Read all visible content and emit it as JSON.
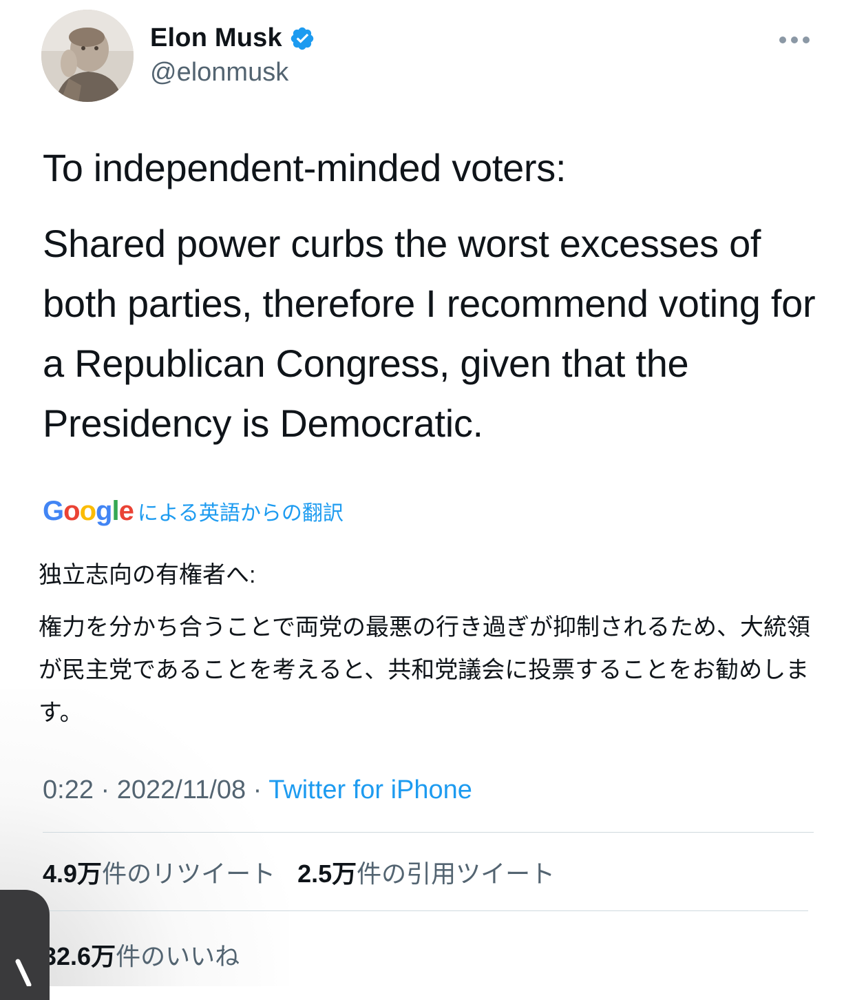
{
  "author": {
    "name": "Elon Musk",
    "handle": "@elonmusk",
    "verified_color": "#1d9bf0"
  },
  "tweet": {
    "line1": "To independent-minded voters:",
    "line2": "Shared power curbs the worst excesses of both parties, therefore I recommend voting for a Republican Congress, given that the Presidency is Democratic."
  },
  "translation": {
    "provider": "Google",
    "label": "による英語からの翻訳",
    "text1": "独立志向の有権者へ:",
    "text2": "権力を分かち合うことで両党の最悪の行き過ぎが抑制されるため、大統領が民主党であることを考えると、共和党議会に投票することをお勧めします。"
  },
  "meta": {
    "time": "0:22",
    "sep1": " · ",
    "date": "2022/11/08",
    "sep2": " · ",
    "source": "Twitter for iPhone"
  },
  "stats": {
    "retweets_num": "4.9",
    "retweets_unit": "万",
    "retweets_label": "件のリツイート",
    "quotes_num": "2.5",
    "quotes_unit": "万",
    "quotes_label": "件の引用ツイート",
    "likes_num": "32.6",
    "likes_unit": "万",
    "likes_label": "件のいいね"
  },
  "colors": {
    "accent": "#1d9bf0",
    "secondary_text": "#536471",
    "google_blue": "#4285F4",
    "google_red": "#EA4335",
    "google_yellow": "#FBBC05",
    "google_green": "#34A853"
  },
  "icons": [
    "verified-badge-icon",
    "more-options-icon",
    "avatar-photo"
  ]
}
